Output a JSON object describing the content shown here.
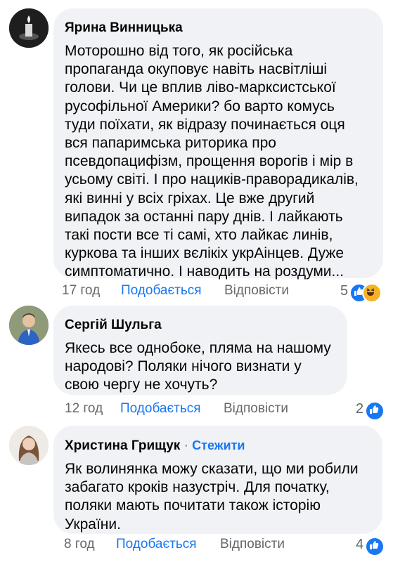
{
  "comments": [
    {
      "author": "Ярина Винницька",
      "text": "Моторошно від того, як російська пропаганда окуповує навіть насвітліші голови. Чи це вплив ліво-марксистської русофільної Америки? бо варто комусь туди поїхати, як відразу починається оця вся папаримська риторика про псевдопацифізм, прощення ворогів і мір в усьому світі. І про нациків-праворадикалів, які винні у всіх гріхах. Це вже другий випадок за останні пару днів. І лайкають такі пости все ті самі, хто лайкає линів, куркова та інших вєлікіх укрАінцев. Дуже симптоматично. І наводить на роздуми...",
      "time": "17 год",
      "like_label": "Подобається",
      "reply_label": "Відповісти",
      "reactions_count": "5",
      "reactions": [
        "like-icon",
        "haha-icon"
      ]
    },
    {
      "author": "Сергій Шульга",
      "text": "Якесь все однобоке, пляма на нашому народові? Поляки нічого визнати у свою чергу не хочуть?",
      "time": "12 год",
      "like_label": "Подобається",
      "reply_label": "Відповісти",
      "reactions_count": "2",
      "reactions": [
        "like-icon"
      ]
    },
    {
      "author": "Христина Грищук",
      "follow_sep": "·",
      "follow_label": "Стежити",
      "text": "Як волинянка можу сказати, що ми робили забагато кроків назустріч. Для початку, поляки мають почитати також історію України.",
      "time": "8 год",
      "like_label": "Подобається",
      "reply_label": "Відповісти",
      "reactions_count": "4",
      "reactions": [
        "like-icon"
      ]
    }
  ],
  "colors": {
    "bubble": "#f0f2f5",
    "accent": "#1877f2",
    "muted": "#65676b",
    "haha": "#f7b125"
  }
}
